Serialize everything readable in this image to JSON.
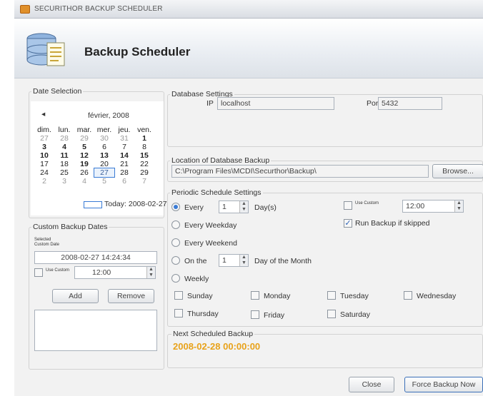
{
  "window": {
    "title": "SECURITHOR BACKUP SCHEDULER"
  },
  "header": {
    "title": "Backup Scheduler"
  },
  "date_selection": {
    "label": "Date Selection",
    "month_title": "février, 2008",
    "prev_arrow": "◂",
    "weekdays": [
      "dim.",
      "lun.",
      "mar.",
      "mer.",
      "jeu.",
      "ven."
    ],
    "weeks": [
      [
        "27",
        "28",
        "29",
        "30",
        "31",
        "1"
      ],
      [
        "3",
        "4",
        "5",
        "6",
        "7",
        "8"
      ],
      [
        "10",
        "11",
        "12",
        "13",
        "14",
        "15"
      ],
      [
        "17",
        "18",
        "19",
        "20",
        "21",
        "22"
      ],
      [
        "24",
        "25",
        "26",
        "27",
        "28",
        "29"
      ],
      [
        "2",
        "3",
        "4",
        "5",
        "6",
        "7"
      ]
    ],
    "today_label": "Today: 2008-02-27"
  },
  "custom_backup": {
    "label": "Custom Backup Dates",
    "selected_label": "Selected Custom Date",
    "selected_value": "2008-02-27 14:24:34",
    "use_custom_label": "Use Custom",
    "time_value": "12:00",
    "add_label": "Add",
    "remove_label": "Remove"
  },
  "database_settings": {
    "label": "Database Settings",
    "ip_label": "IP",
    "ip_value": "localhost",
    "port_label": "Port",
    "port_value": "5432"
  },
  "location": {
    "label": "Location of Database Backup",
    "path": "C:\\Program Files\\MCDI\\Securthor\\Backup\\",
    "browse_label": "Browse..."
  },
  "periodic": {
    "label": "Periodic Schedule Settings",
    "every_label": "Every",
    "every_value": "1",
    "days_label": "Day(s)",
    "use_custom_label": "Use Custom",
    "custom_time": "12:00",
    "run_backup_label": "Run Backup if skipped",
    "every_weekday_label": "Every Weekday",
    "every_weekend_label": "Every Weekend",
    "on_the_label": "On the",
    "on_the_value": "1",
    "day_of_month_label": "Day of the Month",
    "weekly_label": "Weekly",
    "days": [
      "Sunday",
      "Monday",
      "Tuesday",
      "Wednesday",
      "Thursday",
      "Friday",
      "Saturday"
    ]
  },
  "next_backup": {
    "label": "Next Scheduled Backup",
    "value": "2008-02-28 00:00:00",
    "color": "#e8a21a"
  },
  "footer": {
    "close_label": "Close",
    "force_label": "Force Backup Now"
  }
}
